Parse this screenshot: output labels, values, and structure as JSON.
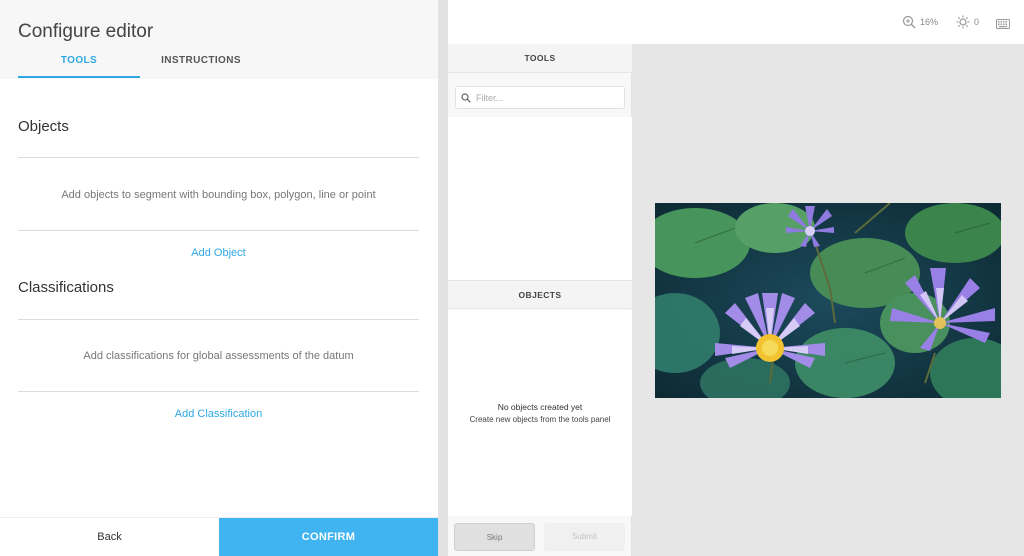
{
  "config": {
    "title": "Configure editor",
    "tabs": [
      {
        "label": "TOOLS",
        "active": true
      },
      {
        "label": "INSTRUCTIONS",
        "active": false
      }
    ],
    "objects": {
      "heading": "Objects",
      "empty_text": "Add objects to segment with bounding box, polygon, line or point",
      "add_label": "Add Object"
    },
    "classifications": {
      "heading": "Classifications",
      "empty_text": "Add classifications for global assessments of the datum",
      "add_label": "Add Classification"
    },
    "footer": {
      "back_label": "Back",
      "confirm_label": "CONFIRM"
    }
  },
  "editor": {
    "toolbar": {
      "zoom_value": "16%",
      "brightness_value": "0",
      "icons": [
        "zoom-icon",
        "brightness-icon",
        "keyboard-icon"
      ]
    },
    "tools_panel": {
      "header": "TOOLS",
      "filter_placeholder": "Filter..."
    },
    "objects_panel": {
      "header": "OBJECTS",
      "empty_title": "No objects created yet",
      "empty_subtitle": "Create new objects from the tools panel"
    },
    "actions": {
      "skip_label": "Skip",
      "submit_label": "Submit"
    },
    "image": {
      "subject": "purple water lilies among green lily pads"
    }
  },
  "colors": {
    "accent": "#2ea8e3",
    "confirm_bg": "#3fb4f0",
    "canvas_bg": "#e6e6e6"
  }
}
